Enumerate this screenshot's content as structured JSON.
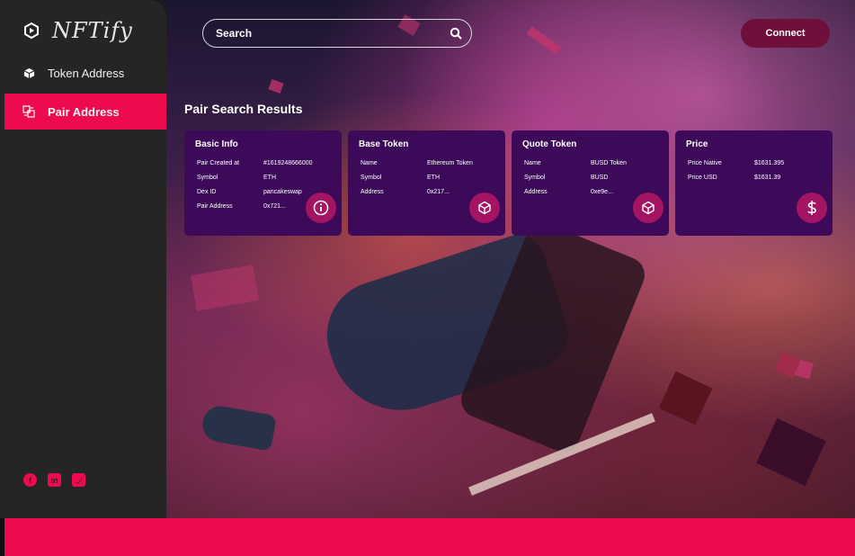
{
  "brand": {
    "name": "NFTify",
    "icon": "hexagon-play-icon"
  },
  "sidebar": {
    "items": [
      {
        "label": "Token Address",
        "icon": "cube-icon",
        "active": false
      },
      {
        "label": "Pair Address",
        "icon": "pair-grid-icon",
        "active": true
      }
    ],
    "socials": [
      "facebook-icon",
      "linkedin-icon",
      "twitter-icon"
    ]
  },
  "search": {
    "placeholder": "Search",
    "icon": "search-icon"
  },
  "connect_label": "Connect",
  "results_title": "Pair Search Results",
  "cards": {
    "basic": {
      "title": "Basic Info",
      "icon": "info-icon",
      "rows": [
        {
          "key": "Pair Created at",
          "value": "#1619248666000"
        },
        {
          "key": "Symbol",
          "value": "ETH"
        },
        {
          "key": "Dex ID",
          "value": "pancakeswap"
        },
        {
          "key": "Pair Address",
          "value": "0x721..."
        }
      ]
    },
    "base": {
      "title": "Base Token",
      "icon": "cube-icon",
      "rows": [
        {
          "key": "Name",
          "value": "Ethereum Token"
        },
        {
          "key": "Symbol",
          "value": "ETH"
        },
        {
          "key": "Address",
          "value": "0x217..."
        }
      ]
    },
    "quote": {
      "title": "Quote Token",
      "icon": "cube-icon",
      "rows": [
        {
          "key": "Name",
          "value": "BUSD Token"
        },
        {
          "key": "Symbol",
          "value": "BUSD"
        },
        {
          "key": "Address",
          "value": "0xe9e..."
        }
      ]
    },
    "price": {
      "title": "Price",
      "icon": "dollar-icon",
      "rows": [
        {
          "key": "Price Native",
          "value": "$1631.395"
        },
        {
          "key": "Price USD",
          "value": "$1631.39"
        }
      ]
    }
  },
  "colors": {
    "accent": "#ee0a4f",
    "sidebar": "#252525",
    "card": "#3c0a59",
    "badge": "#a31562",
    "connect": "#6e0f3c"
  }
}
